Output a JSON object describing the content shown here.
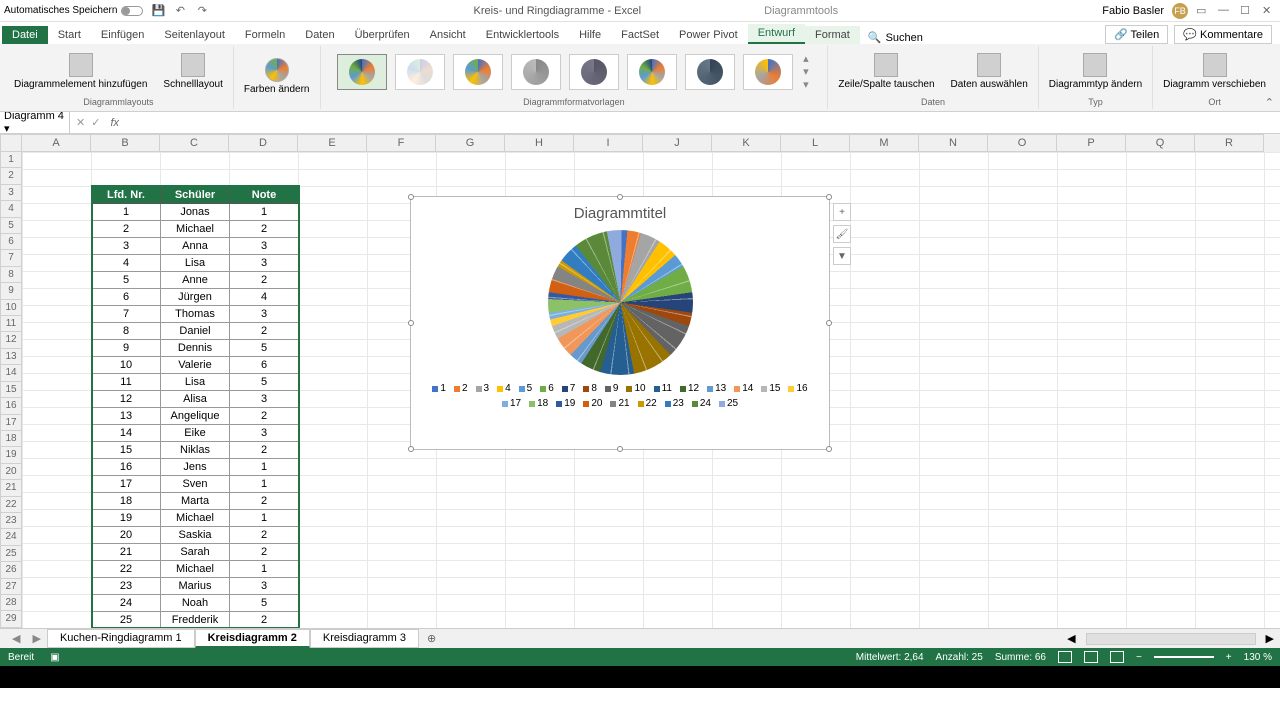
{
  "titlebar": {
    "autosave_label": "Automatisches Speichern",
    "doc_title": "Kreis- und Ringdiagramme - Excel",
    "context_title": "Diagrammtools",
    "user_name": "Fabio Basler",
    "user_initials": "FB"
  },
  "ribbon": {
    "tabs": [
      "Datei",
      "Start",
      "Einfügen",
      "Seitenlayout",
      "Formeln",
      "Daten",
      "Überprüfen",
      "Ansicht",
      "Entwicklertools",
      "Hilfe",
      "FactSet",
      "Power Pivot",
      "Entwurf",
      "Format"
    ],
    "active_tab": "Entwurf",
    "search_placeholder": "Suchen",
    "share": "Teilen",
    "comments": "Kommentare",
    "groups": {
      "layouts": {
        "label": "Diagrammlayouts",
        "add_element": "Diagrammelement hinzufügen",
        "quick_layout": "Schnelllayout"
      },
      "colors": "Farben ändern",
      "styles_label": "Diagrammformatvorlagen",
      "data": {
        "label": "Daten",
        "switch": "Zeile/Spalte tauschen",
        "select": "Daten auswählen"
      },
      "type": {
        "label": "Typ",
        "change": "Diagrammtyp ändern"
      },
      "location": {
        "label": "Ort",
        "move": "Diagramm verschieben"
      }
    }
  },
  "namebox": "Diagramm 4",
  "columns": [
    "A",
    "B",
    "C",
    "D",
    "E",
    "F",
    "G",
    "H",
    "I",
    "J",
    "K",
    "L",
    "M",
    "N",
    "O",
    "P",
    "Q",
    "R"
  ],
  "table": {
    "headers": [
      "Lfd. Nr.",
      "Schüler",
      "Note"
    ],
    "rows": [
      [
        1,
        "Jonas",
        1
      ],
      [
        2,
        "Michael",
        2
      ],
      [
        3,
        "Anna",
        3
      ],
      [
        4,
        "Lisa",
        3
      ],
      [
        5,
        "Anne",
        2
      ],
      [
        6,
        "Jürgen",
        4
      ],
      [
        7,
        "Thomas",
        3
      ],
      [
        8,
        "Daniel",
        2
      ],
      [
        9,
        "Dennis",
        5
      ],
      [
        10,
        "Valerie",
        6
      ],
      [
        11,
        "Lisa",
        5
      ],
      [
        12,
        "Alisa",
        3
      ],
      [
        13,
        "Angelique",
        2
      ],
      [
        14,
        "Eike",
        3
      ],
      [
        15,
        "Niklas",
        2
      ],
      [
        16,
        "Jens",
        1
      ],
      [
        17,
        "Sven",
        1
      ],
      [
        18,
        "Marta",
        2
      ],
      [
        19,
        "Michael",
        1
      ],
      [
        20,
        "Saskia",
        2
      ],
      [
        21,
        "Sarah",
        2
      ],
      [
        22,
        "Michael",
        1
      ],
      [
        23,
        "Marius",
        3
      ],
      [
        24,
        "Noah",
        5
      ],
      [
        25,
        "Fredderik",
        2
      ]
    ]
  },
  "chart_data": {
    "type": "pie",
    "title": "Diagrammtitel",
    "categories": [
      1,
      2,
      3,
      4,
      5,
      6,
      7,
      8,
      9,
      10,
      11,
      12,
      13,
      14,
      15,
      16,
      17,
      18,
      19,
      20,
      21,
      22,
      23,
      24,
      25
    ],
    "values": [
      1,
      2,
      3,
      3,
      2,
      4,
      3,
      2,
      5,
      6,
      5,
      3,
      2,
      3,
      2,
      1,
      1,
      2,
      1,
      2,
      2,
      1,
      3,
      5,
      2
    ],
    "colors": [
      "#4472C4",
      "#ED7D31",
      "#A5A5A5",
      "#FFC000",
      "#5B9BD5",
      "#70AD47",
      "#264478",
      "#9E480E",
      "#636363",
      "#997300",
      "#255E91",
      "#43682B",
      "#6699CC",
      "#F1975A",
      "#B7B7B7",
      "#FFCD33",
      "#7CAFDD",
      "#8CC168",
      "#335AA1",
      "#D26012",
      "#848484",
      "#CC9A00",
      "#327DC2",
      "#5A8A39",
      "#8FAADC"
    ]
  },
  "sheets": {
    "tabs": [
      "Kuchen-Ringdiagramm 1",
      "Kreisdiagramm 2",
      "Kreisdiagramm 3"
    ],
    "active": 1
  },
  "statusbar": {
    "ready": "Bereit",
    "avg": "Mittelwert: 2,64",
    "count": "Anzahl: 25",
    "sum": "Summe: 66",
    "zoom": "130 %"
  }
}
